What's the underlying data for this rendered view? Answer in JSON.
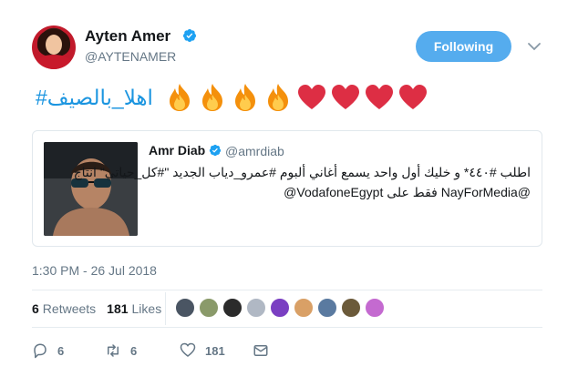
{
  "author": {
    "display_name": "Ayten Amer",
    "handle": "@AYTENAMER"
  },
  "follow_button": {
    "label": "Following"
  },
  "tweet": {
    "hashtag": "#اهلا_بالصيف",
    "emojis": [
      "fire",
      "fire",
      "fire",
      "fire",
      "red-heart",
      "red-heart",
      "red-heart",
      "red-heart"
    ]
  },
  "quoted_tweet": {
    "display_name": "Amr Diab",
    "handle": "@amrdiab",
    "line1": "اطلب #٤٤٠* و خليك أول واحد يسمع أغاني ألبوم #عمرو_دياب الجديد \"#كل_حياتي\" انتاج",
    "line2": "@NayForMedia فقط على VodafoneEgypt@"
  },
  "timestamp": "1:30 PM - 26 Jul 2018",
  "stats": {
    "retweets_count": "6",
    "retweets_label": "Retweets",
    "likes_count": "181",
    "likes_label": "Likes"
  },
  "actions": {
    "reply_count": "6",
    "retweet_count": "6",
    "like_count": "181"
  },
  "colors": {
    "accent": "#1b95e0",
    "follow_bg": "#55acee",
    "muted": "#657786",
    "heart": "#e0245e"
  }
}
